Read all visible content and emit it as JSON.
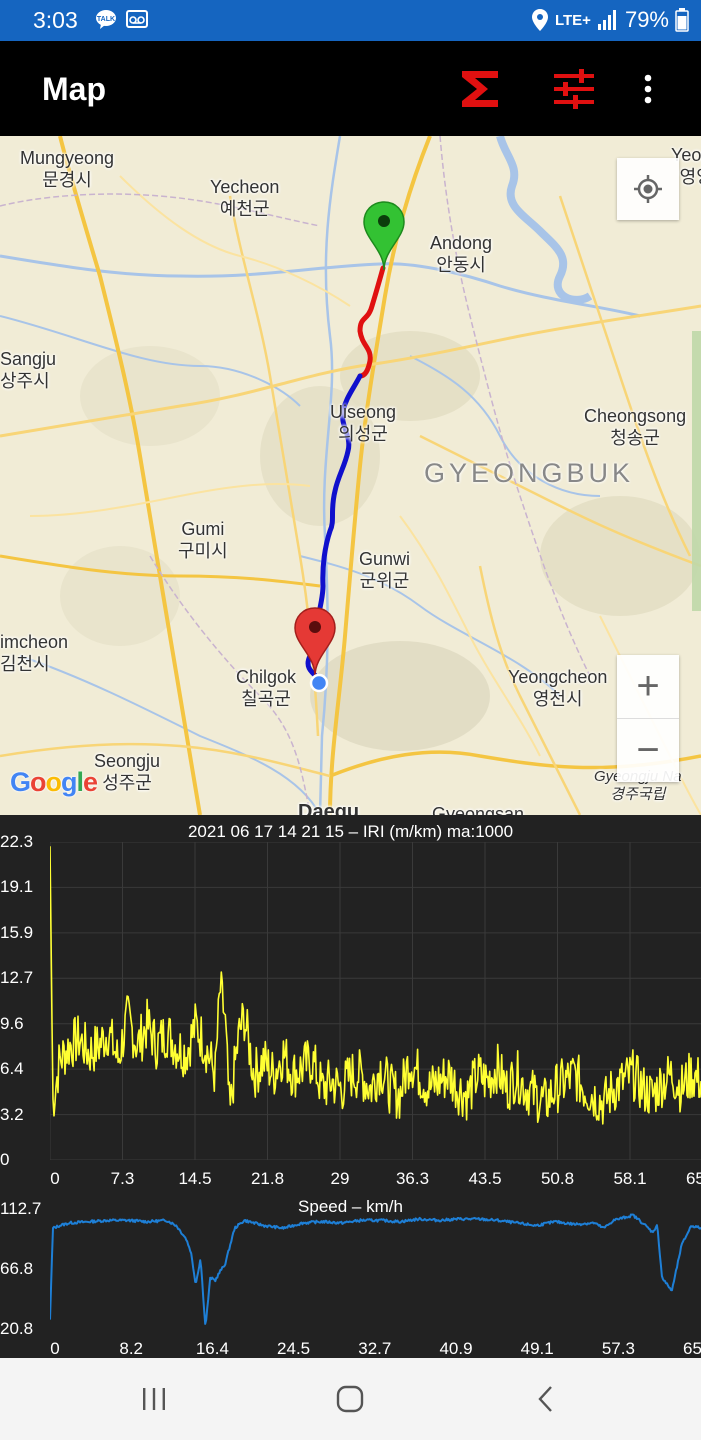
{
  "status": {
    "time": "3:03",
    "network": "LTE+",
    "battery": "79%"
  },
  "appbar": {
    "title": "Map",
    "stats_icon": "sigma-icon",
    "settings_icon": "sliders-icon",
    "menu_icon": "more-vert-icon"
  },
  "map": {
    "places": [
      {
        "en": "Mungyeong",
        "ko": "문경시"
      },
      {
        "en": "Yecheon",
        "ko": "예천군"
      },
      {
        "en": "Andong",
        "ko": "안동시"
      },
      {
        "en": "Yeong",
        "ko": "영양"
      },
      {
        "en": "Sangju",
        "ko": "상주시"
      },
      {
        "en": "Uiseong",
        "ko": "의성군"
      },
      {
        "en": "Cheongsong",
        "ko": "청송군"
      },
      {
        "en": "Gumi",
        "ko": "구미시"
      },
      {
        "en": "Gunwi",
        "ko": "군위군"
      },
      {
        "en": "imcheon",
        "ko": "김천시"
      },
      {
        "en": "Chilgok",
        "ko": "칠곡군"
      },
      {
        "en": "Yeongcheon",
        "ko": "영천시"
      },
      {
        "en": "Seongju",
        "ko": "성주군"
      },
      {
        "en": "Gyeongju Na",
        "ko": "경주국립"
      },
      {
        "en": "Daegu",
        "ko": ""
      },
      {
        "en": "Gyeongsan",
        "ko": ""
      }
    ],
    "region_label": "GYEONGBUK",
    "zoom_in": "+",
    "zoom_out": "−",
    "attribution": "Google",
    "colors": {
      "route_rough": "#e01010",
      "route_smooth": "#1010cc",
      "start_pin": "#33c233",
      "end_pin": "#e53935"
    }
  },
  "iri_chart": {
    "title": "2021 06 17 14 21 15 – IRI (m/km) ma:1000",
    "y_ticks": [
      "22.3",
      "19.1",
      "15.9",
      "12.7",
      "9.6",
      "6.4",
      "3.2",
      "0"
    ],
    "x_ticks": [
      "0",
      "7.3",
      "14.5",
      "21.8",
      "29",
      "36.3",
      "43.5",
      "50.8",
      "58.1",
      "65.3"
    ],
    "color": "#ffff33"
  },
  "speed_chart": {
    "title": "Speed – km/h",
    "y_ticks": [
      "112.7",
      "66.8",
      "20.8"
    ],
    "x_ticks": [
      "0",
      "8.2",
      "16.4",
      "24.5",
      "32.7",
      "40.9",
      "49.1",
      "57.3",
      "65.4"
    ],
    "color": "#1e7fd6"
  },
  "chart_data": [
    {
      "type": "line",
      "title": "2021 06 17 14 21 15 – IRI (m/km) ma:1000",
      "xlabel": "",
      "ylabel": "",
      "xlim": [
        0,
        67
      ],
      "ylim": [
        0,
        22.3
      ],
      "grid": true,
      "x": [
        0,
        0.3,
        1,
        2,
        3,
        4,
        5,
        6,
        7,
        8,
        9,
        10,
        11,
        12,
        13,
        14,
        15,
        16,
        17,
        17.5,
        18,
        18.5,
        19,
        19.5,
        20,
        21,
        22,
        23,
        24,
        25,
        26,
        27,
        28,
        29,
        30,
        31,
        32,
        33,
        34,
        35,
        36,
        37,
        38,
        39,
        40,
        41,
        42,
        43,
        44,
        45,
        46,
        47,
        48,
        49,
        50,
        51,
        52,
        53,
        54,
        55,
        56,
        57,
        58,
        59,
        60,
        61,
        62,
        63,
        64,
        65,
        66,
        67
      ],
      "y": [
        22,
        4,
        7,
        8,
        8.5,
        7.5,
        8,
        9,
        7,
        10,
        8,
        9.5,
        8,
        9,
        8,
        7.5,
        9.5,
        8,
        6,
        12,
        10,
        3,
        6.5,
        9,
        10,
        6,
        7,
        6,
        7.5,
        6,
        6.5,
        7,
        5,
        5.5,
        5,
        6,
        6,
        5,
        6.5,
        5,
        4.5,
        7,
        6,
        5,
        5.5,
        6,
        5,
        4.5,
        6,
        5.5,
        6.5,
        5,
        6,
        5,
        4.5,
        4,
        5,
        5.5,
        6,
        5,
        4.5,
        4,
        5,
        5.5,
        6,
        5,
        4.5,
        5.5,
        6,
        5,
        6,
        5.5
      ]
    },
    {
      "type": "line",
      "title": "Speed – km/h",
      "xlabel": "",
      "ylabel": "",
      "xlim": [
        0,
        67
      ],
      "ylim": [
        20.8,
        112.7
      ],
      "grid": false,
      "x": [
        0,
        0.3,
        1,
        2,
        4,
        6,
        8,
        10,
        12,
        13,
        14,
        14.5,
        15,
        15.5,
        16,
        16.5,
        17,
        17.5,
        18,
        19,
        20,
        22,
        24,
        26,
        28,
        30,
        32,
        34,
        36,
        38,
        40,
        42,
        44,
        46,
        48,
        50,
        52,
        54,
        56,
        57,
        58,
        60,
        61,
        62,
        62.5,
        63,
        64,
        65,
        66,
        67
      ],
      "y": [
        28,
        98,
        100,
        102,
        103,
        104,
        104,
        103,
        104,
        100,
        90,
        80,
        55,
        75,
        22,
        60,
        58,
        65,
        70,
        98,
        104,
        100,
        98,
        102,
        103,
        102,
        104,
        104,
        103,
        105,
        104,
        105,
        105,
        104,
        102,
        100,
        103,
        101,
        102,
        98,
        104,
        108,
        102,
        95,
        100,
        60,
        50,
        85,
        100,
        98
      ]
    }
  ]
}
